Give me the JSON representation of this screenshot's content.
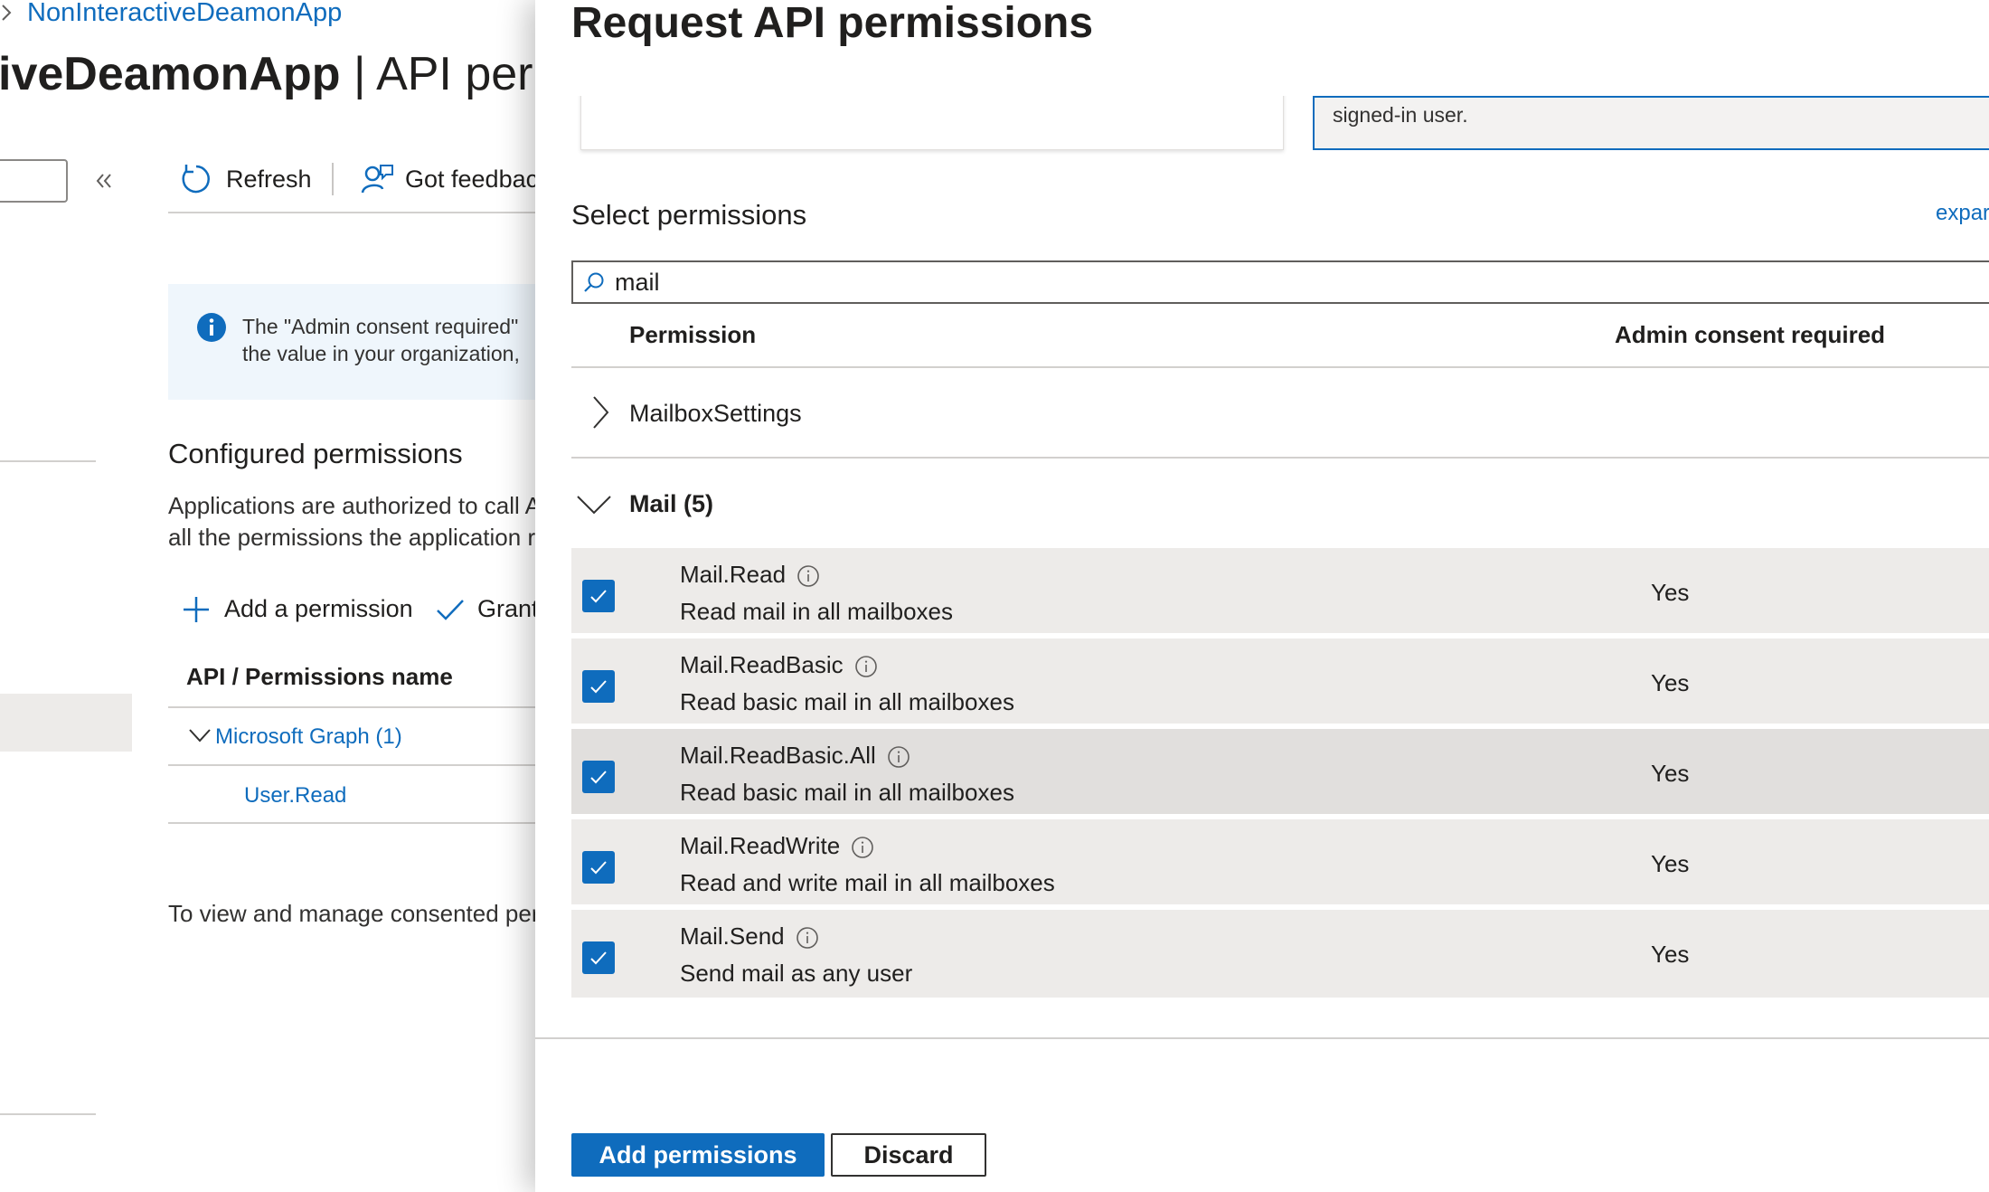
{
  "background_page": {
    "breadcrumb": {
      "item": "NonInteractiveDeamonApp"
    },
    "title": {
      "bold": "iveDeamonApp",
      "light": " | API permis"
    },
    "toolbar": {
      "refresh": "Refresh",
      "feedback": "Got feedbac"
    },
    "info_bar": {
      "line1": "The \"Admin consent required\"",
      "line2": "the value in your organization,"
    },
    "configured": {
      "title": "Configured permissions",
      "desc_line1": "Applications are authorized to call A",
      "desc_line2": "all the permissions the application r"
    },
    "actions": {
      "add": "Add a permission",
      "grant": "Grant"
    },
    "table": {
      "header": "API / Permissions name",
      "group": "Microsoft Graph (1)",
      "item": "User.Read"
    },
    "footer_text": "To view and manage consented per"
  },
  "panel": {
    "title": "Request API permissions",
    "card_right_text": "signed-in user.",
    "select_title": "Select permissions",
    "expand_link": "expar",
    "search": {
      "value": "mail"
    },
    "columns": {
      "permission": "Permission",
      "admin": "Admin consent required"
    },
    "groups": [
      {
        "label": "MailboxSettings",
        "expanded": false
      },
      {
        "label": "Mail (5)",
        "expanded": true
      }
    ],
    "permissions": [
      {
        "name": "Mail.Read",
        "desc": "Read mail in all mailboxes",
        "admin": "Yes",
        "checked": true
      },
      {
        "name": "Mail.ReadBasic",
        "desc": "Read basic mail in all mailboxes",
        "admin": "Yes",
        "checked": true
      },
      {
        "name": "Mail.ReadBasic.All",
        "desc": "Read basic mail in all mailboxes",
        "admin": "Yes",
        "checked": true
      },
      {
        "name": "Mail.ReadWrite",
        "desc": "Read and write mail in all mailboxes",
        "admin": "Yes",
        "checked": true
      },
      {
        "name": "Mail.Send",
        "desc": "Send mail as any user",
        "admin": "Yes",
        "checked": true
      }
    ],
    "buttons": {
      "add": "Add permissions",
      "discard": "Discard"
    }
  },
  "colors": {
    "accent": "#0f6cbd",
    "row_bg": "#edebe9",
    "info_bg": "#eff6fc"
  }
}
